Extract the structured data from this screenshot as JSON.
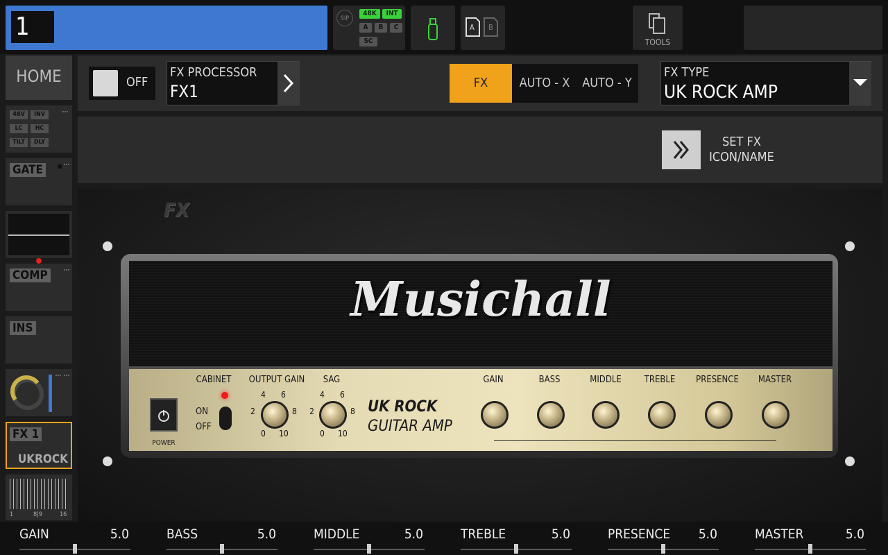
{
  "channel": {
    "number": "1"
  },
  "status": {
    "sip": "SIP",
    "chips": [
      "48K",
      "INT",
      "A",
      "B",
      "C",
      "SC"
    ]
  },
  "sd": {
    "a": "A",
    "b": "B"
  },
  "tools": {
    "label": "TOOLS"
  },
  "sidebar": {
    "home": "HOME",
    "preamp_tags": [
      "48V",
      "INV",
      "LC",
      "HC",
      "TILT",
      "DLY"
    ],
    "gate": "GATE",
    "comp": "COMP",
    "ins": "INS",
    "fx_label": "FX 1",
    "fx_sub": "UKROCK",
    "bus_scale_left": "1",
    "bus_scale_mid": "8|9",
    "bus_scale_right": "16"
  },
  "header": {
    "onoff_label": "OFF",
    "fx_processor_label": "FX PROCESSOR",
    "fx_processor_value": "FX1",
    "mode_fx": "FX",
    "mode_auto_x": "AUTO - X",
    "mode_auto_y": "AUTO - Y",
    "fx_type_label": "FX TYPE",
    "fx_type_value": "UK ROCK AMP",
    "set_fx_line1": "SET FX",
    "set_fx_line2": "ICON/NAME"
  },
  "amp": {
    "brand": "Musichall",
    "fx_logo": "FX",
    "power_label": "POWER",
    "cabinet_label": "CABINET",
    "on_label": "ON",
    "off_label": "OFF",
    "output_gain_label": "OUTPUT GAIN",
    "sag_label": "SAG",
    "model_line1": "UK ROCK",
    "model_line2": "GUITAR AMP",
    "knob_labels": [
      "GAIN",
      "BASS",
      "MIDDLE",
      "TREBLE",
      "PRESENCE",
      "MASTER"
    ],
    "scale": [
      "4",
      "6",
      "2",
      "8",
      "0",
      "10"
    ]
  },
  "params": [
    {
      "name": "GAIN",
      "value": "5.0"
    },
    {
      "name": "BASS",
      "value": "5.0"
    },
    {
      "name": "MIDDLE",
      "value": "5.0"
    },
    {
      "name": "TREBLE",
      "value": "5.0"
    },
    {
      "name": "PRESENCE",
      "value": "5.0"
    },
    {
      "name": "MASTER",
      "value": "5.0"
    }
  ],
  "colors": {
    "channel_blue": "#3f78d1",
    "fx_orange": "#f0a21a",
    "led_green": "#3bd13b"
  }
}
